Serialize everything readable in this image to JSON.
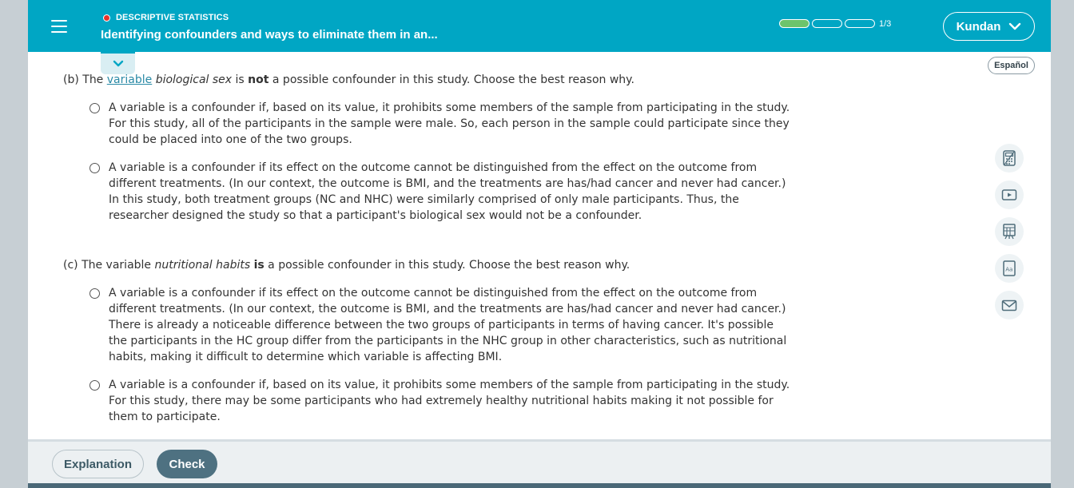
{
  "header": {
    "topic": "DESCRIPTIVE STATISTICS",
    "lesson_title": "Identifying confounders and ways to eliminate them in an...",
    "progress_text": "1/3",
    "progress_fraction": 0.333,
    "user_name": "Kundan",
    "accent_color": "#00a6c4"
  },
  "language_button": "Español",
  "part_b": {
    "prefix": "(b) The ",
    "link": "variable",
    "after_link": " ",
    "italic": "biological sex",
    "mid": " is ",
    "bold": "not",
    "suffix": " a possible confounder in this study. Choose the best reason why.",
    "options": [
      {
        "lines": [
          "A variable is a confounder if, based on its value, it prohibits some members of the sample from participating in the study.",
          "For this study, all of the participants in the sample were male. So, each person in the sample could participate since they",
          "could be placed into one of the two groups."
        ]
      },
      {
        "lines": [
          "A variable is a confounder if its effect on the outcome cannot be distinguished from the effect on the outcome from",
          "different treatments. (In our context, the outcome is BMI, and the treatments are has/had cancer and never had cancer.)",
          "In this study, both treatment groups (NC and NHC) were similarly comprised of only male participants. Thus, the",
          "researcher designed the study so that a participant's biological sex would not be a confounder."
        ]
      }
    ]
  },
  "part_c": {
    "prefix": "(c) The variable ",
    "italic": "nutritional habits",
    "mid": " ",
    "bold": "is",
    "suffix": " a possible confounder in this study. Choose the best reason why.",
    "options": [
      {
        "lines": [
          "A variable is a confounder if its effect on the outcome cannot be distinguished from the effect on the outcome from",
          "different treatments. (In our context, the outcome is BMI, and the treatments are has/had cancer and never had cancer.)",
          "There is already a noticeable difference between the two groups of participants in terms of having cancer. It's possible",
          "the participants in the HC group differ from the participants in the NHC group in other characteristics, such as nutritional",
          "habits, making it difficult to determine which variable is affecting BMI."
        ]
      },
      {
        "lines": [
          "A variable is a confounder if, based on its value, it prohibits some members of the sample from participating in the study.",
          "For this study, there may be some participants who had extremely healthy nutritional habits making it not possible for",
          "them to participate."
        ]
      }
    ]
  },
  "tools": [
    "calculator-icon",
    "video-icon",
    "data-table-icon",
    "glossary-icon",
    "mail-icon"
  ],
  "footer": {
    "explanation_label": "Explanation",
    "check_label": "Check"
  }
}
